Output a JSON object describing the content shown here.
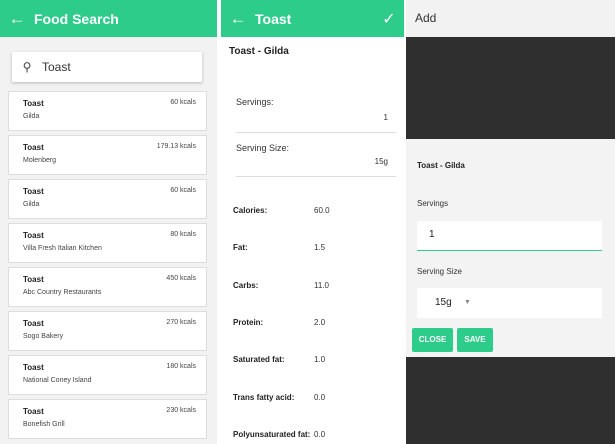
{
  "search_screen": {
    "title": "Food Search",
    "query": "Toast",
    "results": [
      {
        "name": "Toast",
        "brand": "Gilda",
        "kcal": "60 kcals"
      },
      {
        "name": "Toast",
        "brand": "Molenberg",
        "kcal": "179.13 kcals"
      },
      {
        "name": "Toast",
        "brand": "Gilda",
        "kcal": "60 kcals"
      },
      {
        "name": "Toast",
        "brand": "Villa Fresh Italian Kitchen",
        "kcal": "80 kcals"
      },
      {
        "name": "Toast",
        "brand": "Abc Country Restaurants",
        "kcal": "450 kcals"
      },
      {
        "name": "Toast",
        "brand": "Sogo Bakery",
        "kcal": "270 kcals"
      },
      {
        "name": "Toast",
        "brand": "National Coney Island",
        "kcal": "180 kcals"
      },
      {
        "name": "Toast",
        "brand": "Bonefish Grill",
        "kcal": "230 kcals"
      }
    ]
  },
  "detail_screen": {
    "title": "Toast",
    "item_title": "Toast - Gilda",
    "servings_label": "Servings:",
    "servings_value": "1",
    "serving_size_label": "Serving Size:",
    "serving_size_value": "15g",
    "nutrients": [
      {
        "label": "Calories:",
        "value": "60.0"
      },
      {
        "label": "Fat:",
        "value": "1.5"
      },
      {
        "label": "Carbs:",
        "value": "11.0"
      },
      {
        "label": "Protein:",
        "value": "2.0"
      },
      {
        "label": "Saturated fat:",
        "value": "1.0"
      },
      {
        "label": "Trans fatty acid:",
        "value": "0.0"
      },
      {
        "label": "Polyunsaturated fat:",
        "value": "0.0"
      }
    ]
  },
  "add_screen": {
    "title": "Add",
    "dialog": {
      "title": "Toast - Gilda",
      "servings_label": "Servings",
      "servings_value": "1",
      "serving_size_label": "Serving Size",
      "serving_size_value": "15g",
      "close_label": "CLOSE",
      "save_label": "SAVE"
    }
  },
  "colors": {
    "accent": "#2ecc8a",
    "dim_background": "#2f2f2f"
  }
}
